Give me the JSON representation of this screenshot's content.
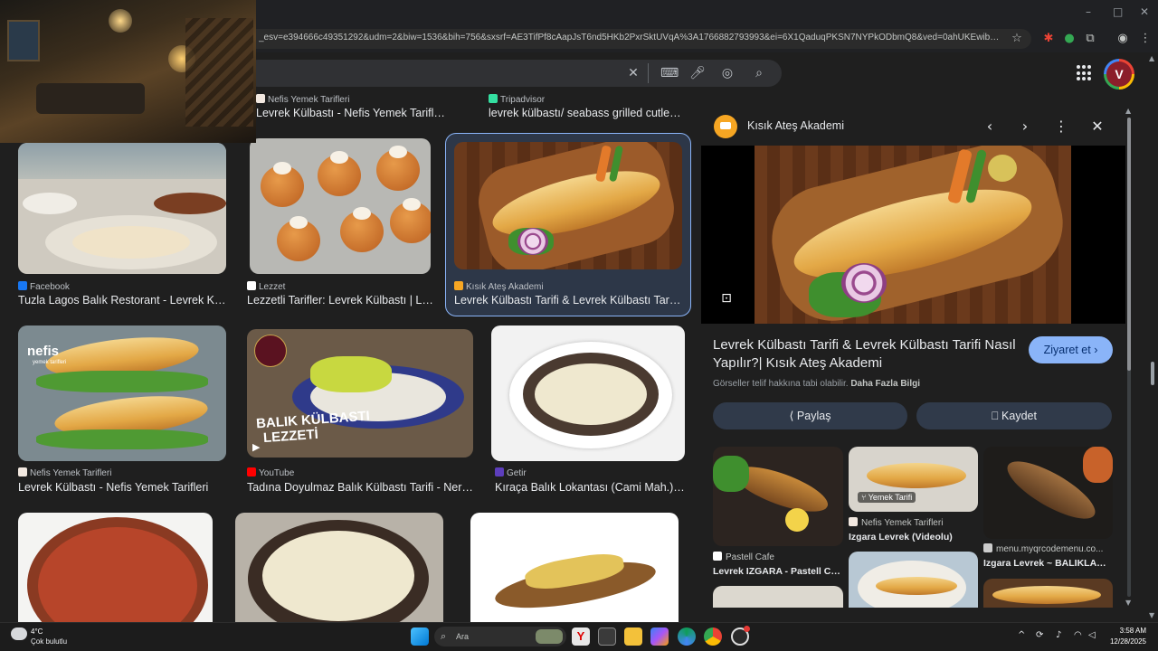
{
  "browser": {
    "url": "_esv=e394666c49351292&udm=2&biw=1536&bih=756&sxsrf=AE3TifPf8cAapJsT6nd5HKb2PxrSktUVqA%3A1766882793993&ei=6X1QaduqPKSN7NYPkODbmQ8&ved=0ahUKEwibw66qh9-RAxWk8ts..."
  },
  "results": [
    {
      "source": "Nefis Yemek Tarifleri",
      "title": "Levrek Külbastı - Nefis Yemek Tarifleri",
      "fav_color": "#f2e8e0"
    },
    {
      "source": "Tripadvisor",
      "title": "levrek külbastı/ seabass grilled cutlet ...",
      "fav_color": "#34e0a1"
    },
    {
      "source": "Facebook",
      "title": "Tuzla Lagos Balık Restorant - Levrek Kül...",
      "fav_color": "#1877f2"
    },
    {
      "source": "Lezzet",
      "title": "Lezzetli Tarifler: Levrek Külbastı | Le...",
      "fav_color": "#ffffff"
    },
    {
      "source": "Kısık Ateş Akademi",
      "title": "Levrek Külbastı Tarifi & Levrek Külbastı Tarifl...",
      "fav_color": "#f6a623"
    },
    {
      "source": "Nefis Yemek Tarifleri",
      "title": "Levrek Külbastı - Nefis Yemek Tarifleri",
      "fav_color": "#f2e8e0"
    },
    {
      "source": "YouTube",
      "title": "Tadına Doyulmaz Balık Külbastı Tarifi - Nerm...",
      "fav_color": "#ff0000"
    },
    {
      "source": "Getir",
      "title": "Kıraça Balık Lokantası (Cami Mah.) ...",
      "fav_color": "#5d3ebc"
    }
  ],
  "thumb_text": {
    "nefis_brand": "nefis",
    "nefis_sub": "yemek tarifleri",
    "video_title_1": "BALIK KÜLBASTI",
    "video_title_2": "LEZZETİ"
  },
  "panel": {
    "source": "Kısık Ateş Akademi",
    "title": "Levrek Külbastı Tarifi & Levrek Külbastı Tarifi Nasıl Yapılır?| Kısık Ateş Akademi",
    "visit_label": "Ziyaret et",
    "copyright": "Görseller telif hakkına tabi olabilir.",
    "more_info": "Daha Fazla Bilgi",
    "share_label": "Paylaş",
    "save_label": "Kaydet",
    "related": [
      {
        "source": "Pastell Cafe",
        "title": "Levrek IZGARA - Pastell Cafe",
        "fav_color": "#ffffff"
      },
      {
        "source": "Nefis Yemek Tarifleri",
        "title": "Izgara Levrek (Videolu)",
        "fav_color": "#f2e8e0",
        "overlay": "Yemek Tarifi"
      },
      {
        "source": "menu.myqrcodemenu.co...",
        "title": "Izgara Levrek ~ BALIKLAR ~...",
        "fav_color": "#cccccc"
      }
    ]
  },
  "taskbar": {
    "temp": "4°C",
    "weather": "Çok bulutlu",
    "search_placeholder": "Ara",
    "time": "3:58 AM",
    "date": "12/28/2025"
  }
}
